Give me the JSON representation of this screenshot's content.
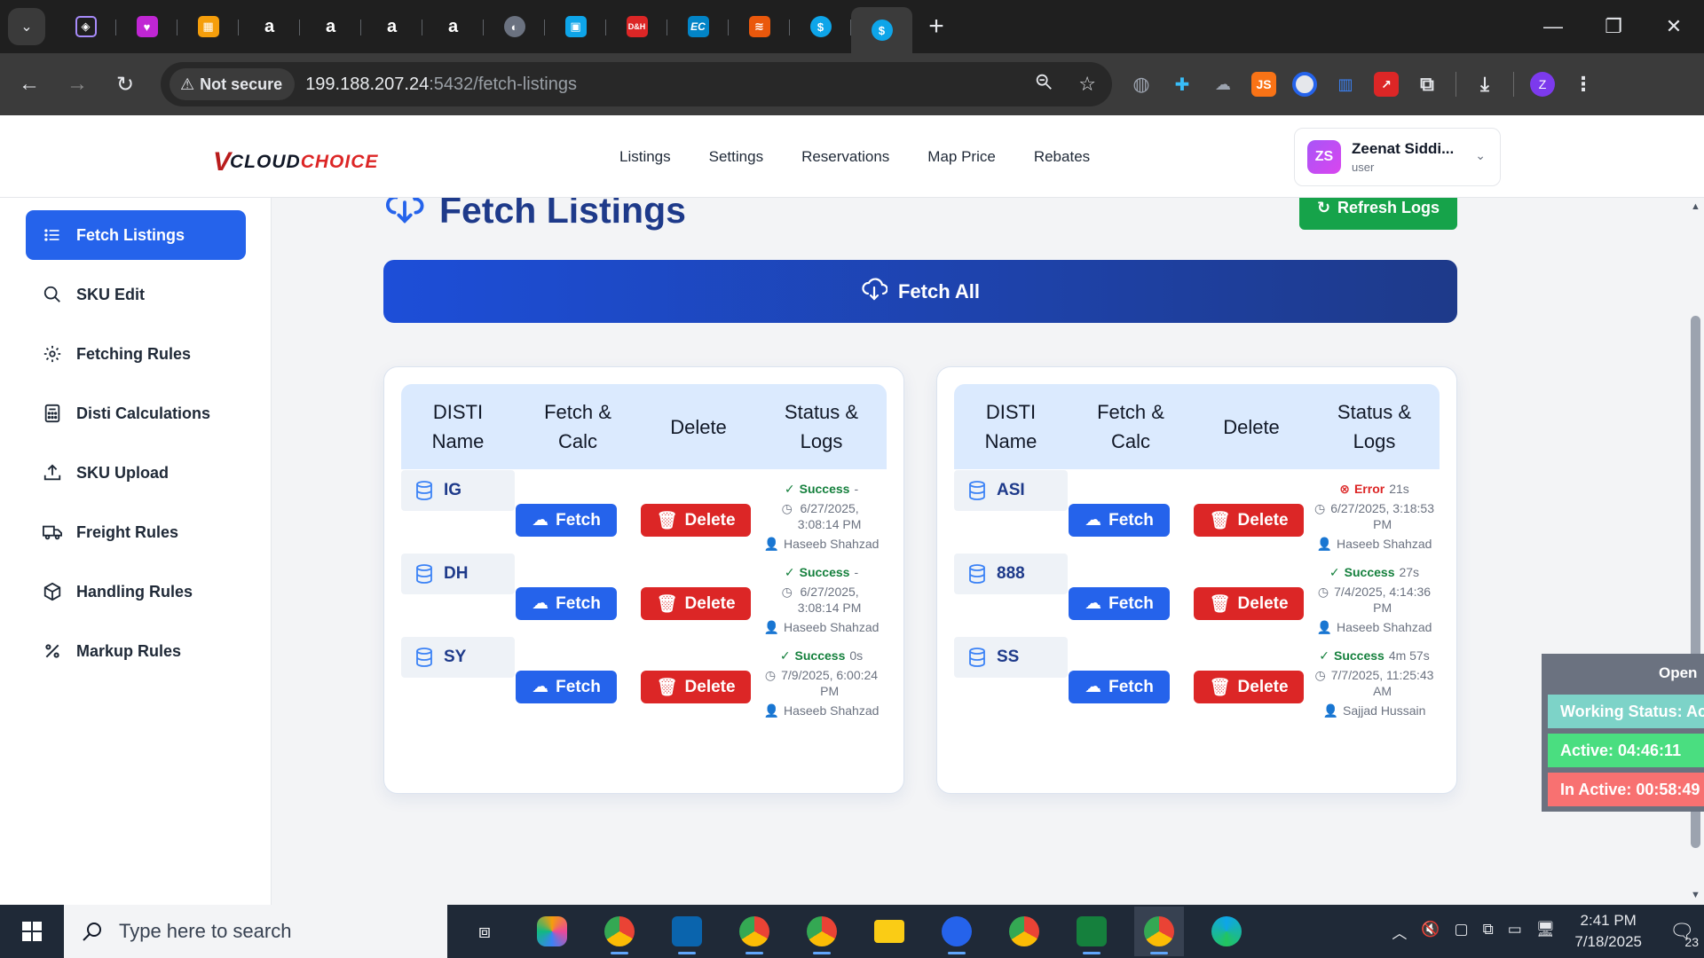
{
  "browser": {
    "tab_count_label": "",
    "new_tab": "+",
    "security_label": "Not secure",
    "url_host": "199.188.207.24",
    "url_rest": ":5432/fetch-listings",
    "profile_initial": "Z"
  },
  "app": {
    "logo_v": "V",
    "logo_part1": "CLOUD",
    "logo_part2": "CHOICE",
    "nav": [
      "Listings",
      "Settings",
      "Reservations",
      "Map Price",
      "Rebates"
    ],
    "user": {
      "initials": "ZS",
      "name": "Zeenat Siddi...",
      "role": "user"
    }
  },
  "sidebar": {
    "items": [
      {
        "label": "Fetch Listings",
        "icon": "list-icon",
        "active": true
      },
      {
        "label": "SKU Edit",
        "icon": "search-icon"
      },
      {
        "label": "Fetching Rules",
        "icon": "gear-icon"
      },
      {
        "label": "Disti Calculations",
        "icon": "calculator-icon"
      },
      {
        "label": "SKU Upload",
        "icon": "upload-icon"
      },
      {
        "label": "Freight Rules",
        "icon": "truck-icon"
      },
      {
        "label": "Handling Rules",
        "icon": "package-icon"
      },
      {
        "label": "Markup Rules",
        "icon": "percent-icon"
      }
    ]
  },
  "main": {
    "title": "Fetch Listings",
    "refresh_label": "Refresh Logs",
    "fetch_all_label": "Fetch All",
    "headers": {
      "disti_line1": "DISTI",
      "disti_line2": "Name",
      "fetch_line1": "Fetch &",
      "fetch_line2": "Calc",
      "delete": "Delete",
      "status_line1": "Status &",
      "status_line2": "Logs"
    },
    "fetch_label": "Fetch",
    "delete_label": "Delete",
    "left_rows": [
      {
        "name": "IG",
        "status": "Success",
        "duration": "-",
        "date": "6/27/2025,",
        "time": "3:08:14 PM",
        "user": "Haseeb Shahzad"
      },
      {
        "name": "DH",
        "status": "Success",
        "duration": "-",
        "date": "6/27/2025,",
        "time": "3:08:14 PM",
        "user": "Haseeb Shahzad"
      },
      {
        "name": "SY",
        "status": "Success",
        "duration": "0s",
        "date": "7/9/2025, 6:00:24",
        "time": "PM",
        "user": "Haseeb Shahzad"
      }
    ],
    "right_rows": [
      {
        "name": "ASI",
        "status": "Error",
        "duration": "21s",
        "date": "6/27/2025, 3:18:53",
        "time": "PM",
        "user": "Haseeb Shahzad"
      },
      {
        "name": "888",
        "status": "Success",
        "duration": "27s",
        "date": "7/4/2025, 4:14:36",
        "time": "PM",
        "user": "Haseeb Shahzad"
      },
      {
        "name": "SS",
        "status": "Success",
        "duration": "4m 57s",
        "date": "7/7/2025, 11:25:43",
        "time": "AM",
        "user": "Sajjad Hussain"
      }
    ]
  },
  "widget": {
    "open_label": "Open",
    "working_status": "Working Status: Ac",
    "active": "Active: 04:46:11",
    "inactive": "In Active: 00:58:49"
  },
  "taskbar": {
    "search_placeholder": "Type here to search",
    "time": "2:41 PM",
    "date": "7/18/2025",
    "notification_count": "23"
  },
  "colors": {
    "primary": "#2563eb",
    "title": "#1e3a8a",
    "success": "#16a34a",
    "danger": "#dc2626"
  }
}
